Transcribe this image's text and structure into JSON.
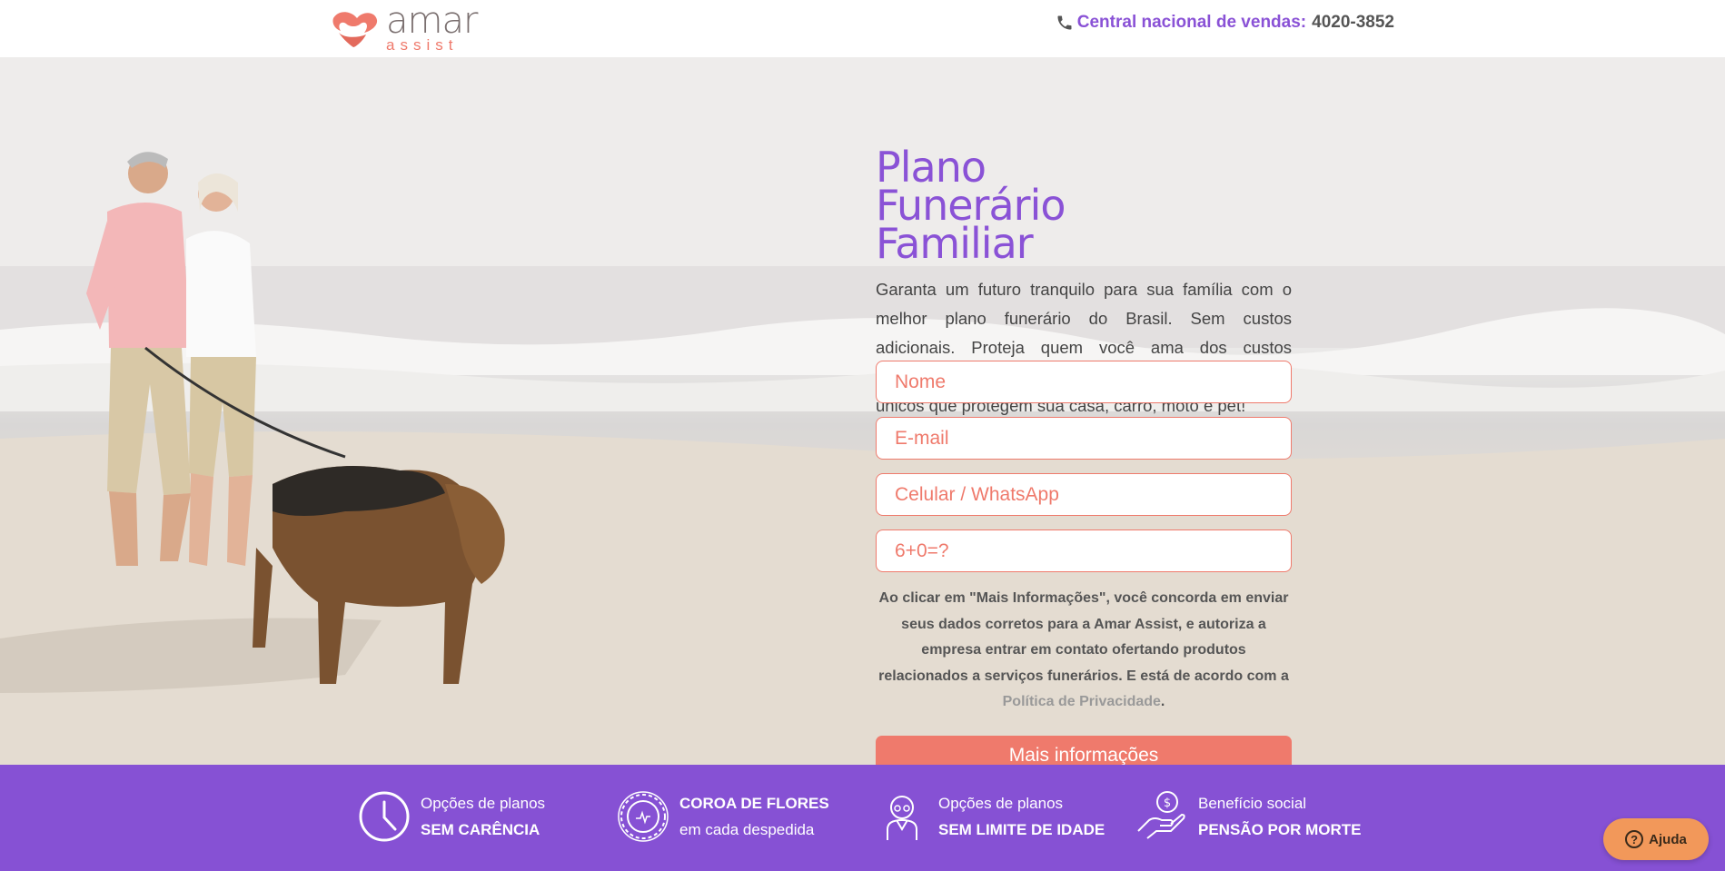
{
  "header": {
    "logo_main": "amar",
    "logo_sub": "assist",
    "phone_label": "Central nacional de vendas:",
    "phone_number": "4020-3852"
  },
  "hero": {
    "title": "Plano Funerário Familiar",
    "description": "Garanta um futuro tranquilo para sua família com o melhor plano funerário do Brasil. Sem custos adicionais. Proteja quem você ama dos custos elevados no momento da despedida e tenha benefícios únicos que protegem sua casa, carro, moto e pet!"
  },
  "form": {
    "name_placeholder": "Nome",
    "email_placeholder": "E-mail",
    "phone_placeholder": "Celular / WhatsApp",
    "captcha_placeholder": "6+0=?",
    "consent_text": "Ao clicar em \"Mais Informações\", você concorda em enviar seus dados corretos para a Amar Assist, e autoriza a empresa entrar em contato ofertando produtos relacionados a serviços funerários. E está de acordo com a ",
    "privacy_link": "Política de Privacidade",
    "consent_end": ".",
    "submit_label": "Mais informações"
  },
  "benefits": [
    {
      "icon": "clock-icon",
      "line1": "Opções de planos",
      "line2": "SEM CARÊNCIA"
    },
    {
      "icon": "flower-wreath-icon",
      "line1": "COROA DE FLORES",
      "line2": "em cada despedida"
    },
    {
      "icon": "elderly-person-icon",
      "line1": "Opções de planos",
      "line2": "SEM LIMITE DE IDADE"
    },
    {
      "icon": "hand-money-icon",
      "line1": "Benefício social",
      "line2": "PENSÃO POR MORTE"
    }
  ],
  "help": {
    "label": "Ajuda"
  },
  "colors": {
    "brand_purple": "#8651d4",
    "title_purple": "#8a52d6",
    "coral": "#ef7a6c",
    "help_orange": "#f2985a"
  }
}
